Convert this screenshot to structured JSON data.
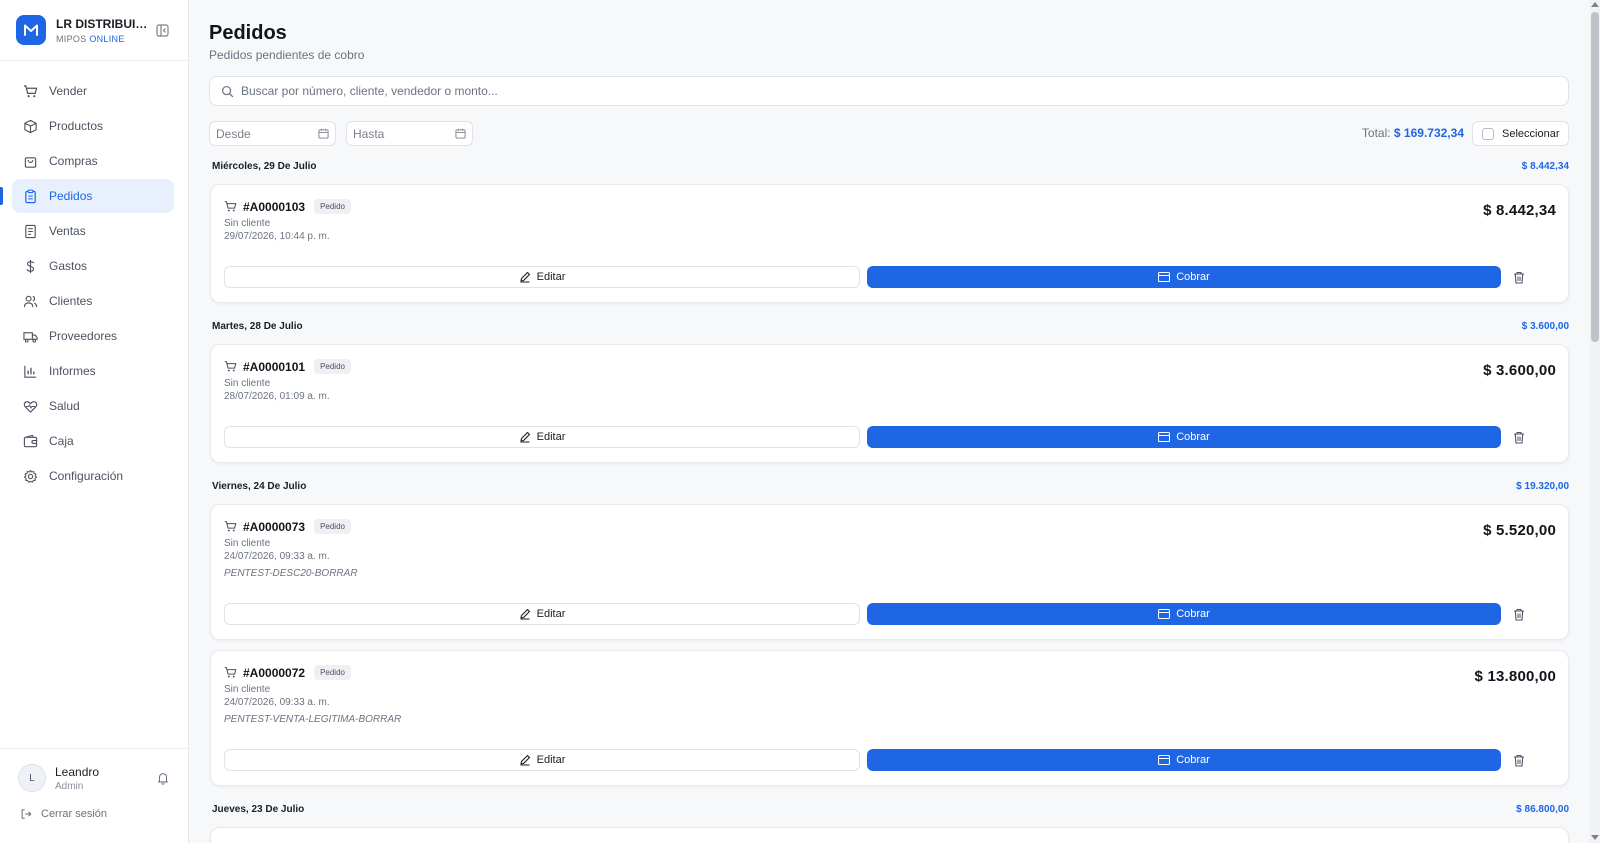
{
  "brand": {
    "name": "LR DISTRIBUID...",
    "sub_prefix": "MIPOS",
    "sub_accent": "ONLINE",
    "accent_color": "#1f66e5"
  },
  "sidebar": {
    "items": [
      {
        "label": "Vender",
        "icon": "cart-icon"
      },
      {
        "label": "Productos",
        "icon": "box-icon"
      },
      {
        "label": "Compras",
        "icon": "bag-icon"
      },
      {
        "label": "Pedidos",
        "icon": "clipboard-icon",
        "active": true
      },
      {
        "label": "Ventas",
        "icon": "receipt-icon"
      },
      {
        "label": "Gastos",
        "icon": "dollar-icon"
      },
      {
        "label": "Clientes",
        "icon": "users-icon"
      },
      {
        "label": "Proveedores",
        "icon": "truck-icon"
      },
      {
        "label": "Informes",
        "icon": "bar-chart-icon"
      },
      {
        "label": "Salud",
        "icon": "heart-pulse-icon"
      },
      {
        "label": "Caja",
        "icon": "wallet-icon"
      },
      {
        "label": "Configuración",
        "icon": "gear-icon"
      }
    ],
    "user": {
      "initial": "L",
      "name": "Leandro",
      "role": "Admin"
    },
    "logout_label": "Cerrar sesión"
  },
  "header": {
    "title": "Pedidos",
    "subtitle": "Pedidos pendientes de cobro"
  },
  "search": {
    "placeholder": "Buscar por número, cliente, vendedor o monto...",
    "value": ""
  },
  "filters": {
    "from_placeholder": "Desde",
    "to_placeholder": "Hasta",
    "total_label": "Total:",
    "total_value": "$ 169.732,34",
    "select_label": "Seleccionar"
  },
  "groups": [
    {
      "day": "Miércoles, 29 De Julio",
      "amount": "$ 8.442,34"
    },
    {
      "day": "Martes, 28 De Julio",
      "amount": "$ 3.600,00"
    },
    {
      "day": "Viernes, 24 De Julio",
      "amount": "$ 19.320,00"
    },
    {
      "day": "Jueves, 23 De Julio",
      "amount": "$ 86.800,00"
    }
  ],
  "orders": [
    {
      "number": "#A0000103",
      "badge": "Pedido",
      "client": "Sin cliente",
      "date": "29/07/2026, 10:44 p. m.",
      "note": "",
      "amount": "$ 8.442,34"
    },
    {
      "number": "#A0000101",
      "badge": "Pedido",
      "client": "Sin cliente",
      "date": "28/07/2026, 01:09 a. m.",
      "note": "",
      "amount": "$ 3.600,00"
    },
    {
      "number": "#A0000073",
      "badge": "Pedido",
      "client": "Sin cliente",
      "date": "24/07/2026, 09:33 a. m.",
      "note": "PENTEST-DESC20-BORRAR",
      "amount": "$ 5.520,00"
    },
    {
      "number": "#A0000072",
      "badge": "Pedido",
      "client": "Sin cliente",
      "date": "24/07/2026, 09:33 a. m.",
      "note": "PENTEST-VENTA-LEGITIMA-BORRAR",
      "amount": "$ 13.800,00"
    }
  ],
  "actions": {
    "edit_label": "Editar",
    "pay_label": "Cobrar"
  }
}
